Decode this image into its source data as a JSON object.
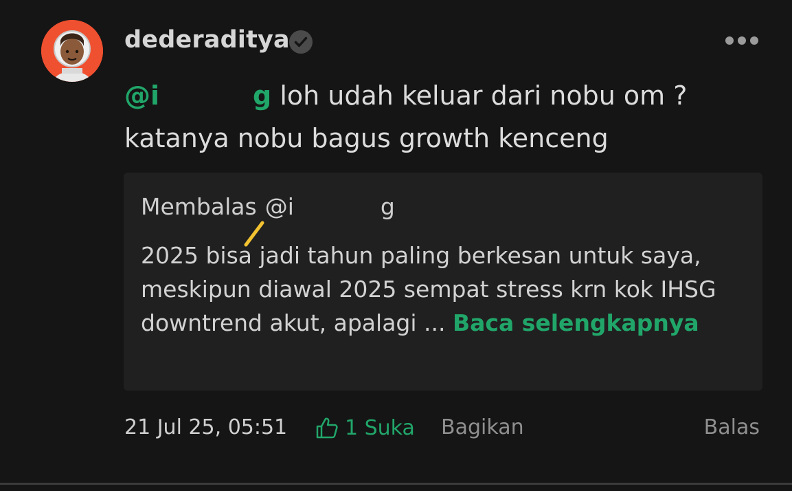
{
  "post": {
    "username": "dederaditya",
    "verified": true,
    "avatar": "astronaut-avatar",
    "comment": {
      "mention_start": "@i",
      "mention_end": "g",
      "text": " loh udah keluar dari nobu om ? katanya nobu bagus growth kenceng"
    },
    "quote": {
      "prefix": "Membalas",
      "mention_start": "@i",
      "mention_end": "g",
      "text": "2025 bisa jadi tahun paling berkesan untuk saya, meskipun diawal 2025 sempat stress krn kok IHSG downtrend akut, apalagi ... ",
      "read_more": "Baca selengkapnya"
    },
    "footer": {
      "timestamp": "21 Jul 25, 05:51",
      "like_label": "1 Suka",
      "share_label": "Bagikan",
      "reply_label": "Balas"
    }
  },
  "colors": {
    "background": "#151515",
    "accent": "#21a66a",
    "quote_bg": "#202020",
    "avatar_bg": "#ef5030"
  },
  "icons": [
    "verified-check-icon",
    "more-options-icon",
    "thumbs-up-icon"
  ]
}
